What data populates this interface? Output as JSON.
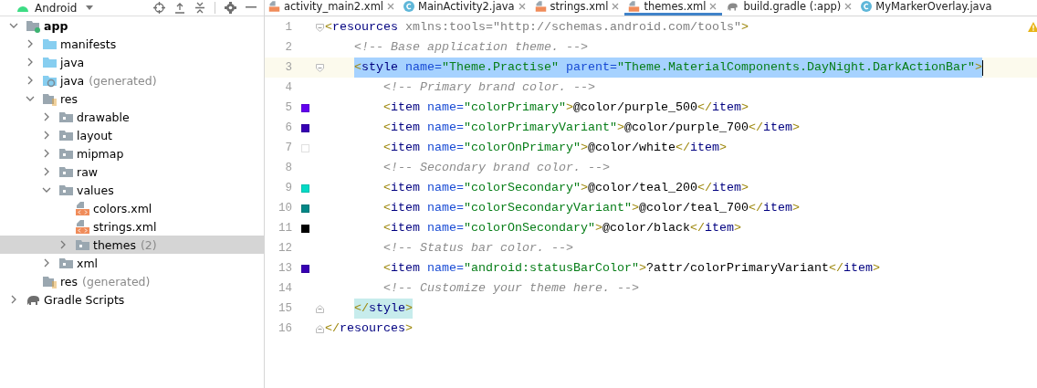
{
  "project_panel": {
    "view_selector": "Android",
    "tree": [
      {
        "label": "app",
        "kind": "module",
        "expanded": true,
        "selected": false,
        "bold": true,
        "children": [
          {
            "label": "manifests",
            "kind": "folder",
            "expanded": false,
            "selected": false
          },
          {
            "label": "java",
            "kind": "folder",
            "expanded": false,
            "selected": false
          },
          {
            "label": "java",
            "note": "(generated)",
            "kind": "generated",
            "expanded": false,
            "selected": false
          },
          {
            "label": "res",
            "kind": "resources",
            "expanded": true,
            "selected": false,
            "children": [
              {
                "label": "drawable",
                "kind": "package",
                "expanded": false,
                "selected": false
              },
              {
                "label": "layout",
                "kind": "package",
                "expanded": false,
                "selected": false
              },
              {
                "label": "mipmap",
                "kind": "package",
                "expanded": false,
                "selected": false
              },
              {
                "label": "raw",
                "kind": "package",
                "expanded": false,
                "selected": false
              },
              {
                "label": "values",
                "kind": "package",
                "expanded": true,
                "selected": false,
                "children": [
                  {
                    "label": "colors.xml",
                    "kind": "xml",
                    "selected": false
                  },
                  {
                    "label": "strings.xml",
                    "kind": "xml",
                    "selected": false
                  },
                  {
                    "label": "themes",
                    "note": "(2)",
                    "kind": "package",
                    "expanded": false,
                    "selected": true
                  }
                ]
              },
              {
                "label": "xml",
                "kind": "package",
                "expanded": false,
                "selected": false
              }
            ]
          },
          {
            "label": "res",
            "note": "(generated)",
            "kind": "resources",
            "selected": false
          }
        ]
      },
      {
        "label": "Gradle Scripts",
        "kind": "gradle",
        "expanded": false,
        "selected": false
      }
    ]
  },
  "tabs": [
    {
      "label": "activity_main2.xml",
      "kind": "xml",
      "selected": false,
      "closable": true
    },
    {
      "label": "MainActivity2.java",
      "kind": "class",
      "selected": false,
      "closable": true
    },
    {
      "label": "strings.xml",
      "kind": "xml",
      "selected": false,
      "closable": true
    },
    {
      "label": "themes.xml",
      "kind": "xml",
      "selected": true,
      "closable": true
    },
    {
      "label": "build.gradle (:app)",
      "kind": "gradle",
      "selected": false,
      "closable": true
    },
    {
      "label": "MyMarkerOverlay.java",
      "kind": "class",
      "selected": false,
      "closable": false
    }
  ],
  "editor": {
    "warning": true,
    "lines": [
      {
        "number": "1",
        "fold_start": true,
        "fold_end": false,
        "selected": false,
        "matched": false,
        "tokens": [
          {
            "kind": "bracket",
            "text": "<"
          },
          {
            "kind": "tag",
            "text": "resources"
          },
          {
            "kind": "unused",
            "text": " xmlns:tools=\"http://schemas.android.com/tools\""
          },
          {
            "kind": "bracket",
            "text": ">"
          }
        ],
        "children": [
          {
            "number": "2",
            "fold_start": false,
            "fold_end": false,
            "selected": false,
            "matched": false,
            "tokens": [
              {
                "kind": "comment",
                "text": "<!-- Base application theme. -->"
              }
            ]
          },
          {
            "number": "3",
            "fold_start": true,
            "fold_end": false,
            "selected": true,
            "matched": false,
            "tokens": [
              {
                "kind": "bracket",
                "text": "<"
              },
              {
                "kind": "tag",
                "text": "style"
              },
              {
                "kind": "attr",
                "text": " name="
              },
              {
                "kind": "value",
                "text": "\"Theme.Practise\""
              },
              {
                "kind": "attr",
                "text": " parent="
              },
              {
                "kind": "value",
                "text": "\"Theme.MaterialComponents.DayNight.DarkActionBar\""
              },
              {
                "kind": "bracket",
                "text": ">"
              }
            ],
            "children": [
              {
                "number": "4",
                "fold_start": false,
                "fold_end": false,
                "selected": false,
                "matched": false,
                "tokens": [
                  {
                    "kind": "comment",
                    "text": "<!-- Primary brand color. -->"
                  }
                ]
              },
              {
                "number": "5",
                "color": "#6200ee",
                "fold_start": false,
                "fold_end": false,
                "selected": false,
                "matched": false,
                "tokens": [
                  {
                    "kind": "bracket",
                    "text": "<"
                  },
                  {
                    "kind": "tag",
                    "text": "item"
                  },
                  {
                    "kind": "attr",
                    "text": " name="
                  },
                  {
                    "kind": "value",
                    "text": "\"colorPrimary\""
                  },
                  {
                    "kind": "bracket",
                    "text": ">"
                  },
                  {
                    "kind": "text",
                    "text": "@color/purple_500"
                  },
                  {
                    "kind": "bracket",
                    "text": "</"
                  },
                  {
                    "kind": "tag",
                    "text": "item"
                  },
                  {
                    "kind": "bracket",
                    "text": ">"
                  }
                ]
              },
              {
                "number": "6",
                "color": "#3700b3",
                "fold_start": false,
                "fold_end": false,
                "selected": false,
                "matched": false,
                "tokens": [
                  {
                    "kind": "bracket",
                    "text": "<"
                  },
                  {
                    "kind": "tag",
                    "text": "item"
                  },
                  {
                    "kind": "attr",
                    "text": " name="
                  },
                  {
                    "kind": "value",
                    "text": "\"colorPrimaryVariant\""
                  },
                  {
                    "kind": "bracket",
                    "text": ">"
                  },
                  {
                    "kind": "text",
                    "text": "@color/purple_700"
                  },
                  {
                    "kind": "bracket",
                    "text": "</"
                  },
                  {
                    "kind": "tag",
                    "text": "item"
                  },
                  {
                    "kind": "bracket",
                    "text": ">"
                  }
                ]
              },
              {
                "number": "7",
                "color": "#ffffff",
                "fold_start": false,
                "fold_end": false,
                "selected": false,
                "matched": false,
                "tokens": [
                  {
                    "kind": "bracket",
                    "text": "<"
                  },
                  {
                    "kind": "tag",
                    "text": "item"
                  },
                  {
                    "kind": "attr",
                    "text": " name="
                  },
                  {
                    "kind": "value",
                    "text": "\"colorOnPrimary\""
                  },
                  {
                    "kind": "bracket",
                    "text": ">"
                  },
                  {
                    "kind": "text",
                    "text": "@color/white"
                  },
                  {
                    "kind": "bracket",
                    "text": "</"
                  },
                  {
                    "kind": "tag",
                    "text": "item"
                  },
                  {
                    "kind": "bracket",
                    "text": ">"
                  }
                ]
              },
              {
                "number": "8",
                "fold_start": false,
                "fold_end": false,
                "selected": false,
                "matched": false,
                "tokens": [
                  {
                    "kind": "comment",
                    "text": "<!-- Secondary brand color. -->"
                  }
                ]
              },
              {
                "number": "9",
                "color": "#03dac5",
                "fold_start": false,
                "fold_end": false,
                "selected": false,
                "matched": false,
                "tokens": [
                  {
                    "kind": "bracket",
                    "text": "<"
                  },
                  {
                    "kind": "tag",
                    "text": "item"
                  },
                  {
                    "kind": "attr",
                    "text": " name="
                  },
                  {
                    "kind": "value",
                    "text": "\"colorSecondary\""
                  },
                  {
                    "kind": "bracket",
                    "text": ">"
                  },
                  {
                    "kind": "text",
                    "text": "@color/teal_200"
                  },
                  {
                    "kind": "bracket",
                    "text": "</"
                  },
                  {
                    "kind": "tag",
                    "text": "item"
                  },
                  {
                    "kind": "bracket",
                    "text": ">"
                  }
                ]
              },
              {
                "number": "10",
                "color": "#018786",
                "fold_start": false,
                "fold_end": false,
                "selected": false,
                "matched": false,
                "tokens": [
                  {
                    "kind": "bracket",
                    "text": "<"
                  },
                  {
                    "kind": "tag",
                    "text": "item"
                  },
                  {
                    "kind": "attr",
                    "text": " name="
                  },
                  {
                    "kind": "value",
                    "text": "\"colorSecondaryVariant\""
                  },
                  {
                    "kind": "bracket",
                    "text": ">"
                  },
                  {
                    "kind": "text",
                    "text": "@color/teal_700"
                  },
                  {
                    "kind": "bracket",
                    "text": "</"
                  },
                  {
                    "kind": "tag",
                    "text": "item"
                  },
                  {
                    "kind": "bracket",
                    "text": ">"
                  }
                ]
              },
              {
                "number": "11",
                "color": "#000000",
                "fold_start": false,
                "fold_end": false,
                "selected": false,
                "matched": false,
                "tokens": [
                  {
                    "kind": "bracket",
                    "text": "<"
                  },
                  {
                    "kind": "tag",
                    "text": "item"
                  },
                  {
                    "kind": "attr",
                    "text": " name="
                  },
                  {
                    "kind": "value",
                    "text": "\"colorOnSecondary\""
                  },
                  {
                    "kind": "bracket",
                    "text": ">"
                  },
                  {
                    "kind": "text",
                    "text": "@color/black"
                  },
                  {
                    "kind": "bracket",
                    "text": "</"
                  },
                  {
                    "kind": "tag",
                    "text": "item"
                  },
                  {
                    "kind": "bracket",
                    "text": ">"
                  }
                ]
              },
              {
                "number": "12",
                "fold_start": false,
                "fold_end": false,
                "selected": false,
                "matched": false,
                "tokens": [
                  {
                    "kind": "comment",
                    "text": "<!-- Status bar color. -->"
                  }
                ]
              },
              {
                "number": "13",
                "color": "#3700b3",
                "fold_start": false,
                "fold_end": false,
                "selected": false,
                "matched": false,
                "tokens": [
                  {
                    "kind": "bracket",
                    "text": "<"
                  },
                  {
                    "kind": "tag",
                    "text": "item"
                  },
                  {
                    "kind": "attr",
                    "text": " name="
                  },
                  {
                    "kind": "value",
                    "text": "\"android:statusBarColor\""
                  },
                  {
                    "kind": "bracket",
                    "text": ">"
                  },
                  {
                    "kind": "text",
                    "text": "?attr/colorPrimaryVariant"
                  },
                  {
                    "kind": "bracket",
                    "text": "</"
                  },
                  {
                    "kind": "tag",
                    "text": "item"
                  },
                  {
                    "kind": "bracket",
                    "text": ">"
                  }
                ]
              },
              {
                "number": "14",
                "fold_start": false,
                "fold_end": false,
                "selected": false,
                "matched": false,
                "tokens": [
                  {
                    "kind": "comment",
                    "text": "<!-- Customize your theme here. -->"
                  }
                ]
              }
            ]
          },
          {
            "number": "15",
            "fold_start": false,
            "fold_end": true,
            "selected": false,
            "matched": true,
            "tokens": [
              {
                "kind": "bracket",
                "text": "</"
              },
              {
                "kind": "tag",
                "text": "style"
              },
              {
                "kind": "bracket",
                "text": ">"
              }
            ]
          }
        ]
      },
      {
        "number": "16",
        "fold_start": false,
        "fold_end": true,
        "selected": false,
        "matched": false,
        "tokens": [
          {
            "kind": "bracket",
            "text": "</"
          },
          {
            "kind": "tag",
            "text": "resources"
          },
          {
            "kind": "bracket",
            "text": ">"
          }
        ]
      }
    ]
  }
}
